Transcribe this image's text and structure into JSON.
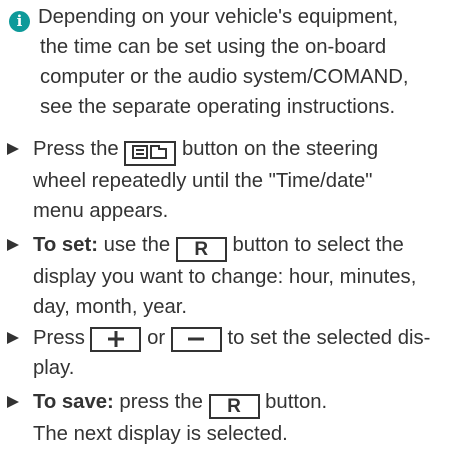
{
  "note": {
    "icon": "info-icon",
    "icon_glyph": "i",
    "line1": "Depending on your vehicle's equipment,",
    "line2": "the time can be set using the on-board",
    "line3": "computer or the audio system/COMAND,",
    "line4": "see the separate operating instructions."
  },
  "steps": [
    {
      "line1_before": "Press the",
      "button_icon": "display-menu-icon",
      "line1_after": "button on the steering",
      "line2": "wheel repeatedly until the \"Time/date\"",
      "line3": "menu appears."
    },
    {
      "bold": "To set:",
      "line1_before": "use the",
      "key": "R",
      "line1_after": "button to select the",
      "line2": "display you want to change: hour, minutes,",
      "line3": "day, month, year."
    },
    {
      "line1_before": "Press",
      "key_plus_icon": "plus-icon",
      "line1_mid": "or",
      "key_minus_icon": "minus-icon",
      "line1_after": "to set the selected dis-",
      "line2": "play."
    },
    {
      "bold": "To save:",
      "line1_before": "press the",
      "key": "R",
      "line1_after": "button.",
      "line2": "The next display is selected."
    }
  ]
}
